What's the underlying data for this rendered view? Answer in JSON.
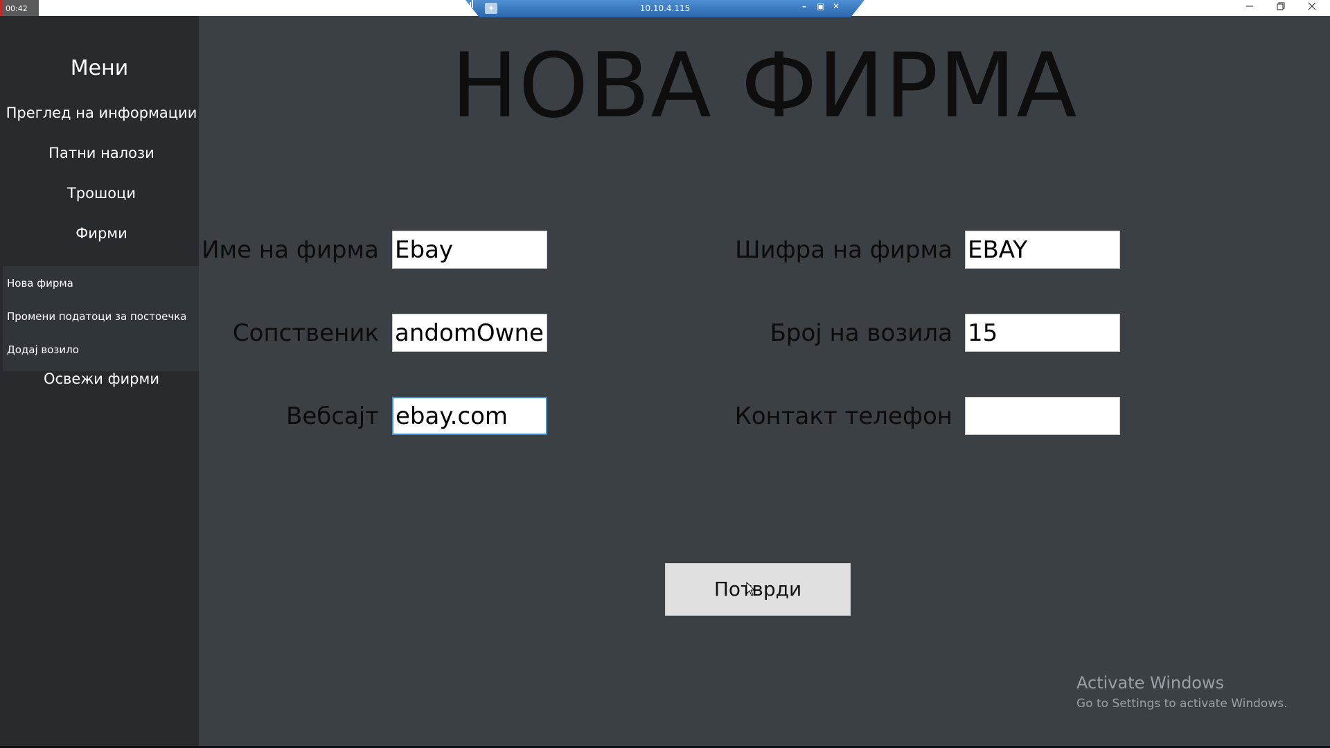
{
  "titlebar": {
    "clock": "00:42",
    "rdp_host": "10.10.4.115",
    "rdp_minimize": "–",
    "rdp_restore": "▣",
    "rdp_close": "✕"
  },
  "sidebar": {
    "title": "Мени",
    "items": [
      {
        "label": "Преглед на информации"
      },
      {
        "label": "Патни налози"
      },
      {
        "label": "Трошоци"
      },
      {
        "label": "Фирми"
      }
    ],
    "subitems": [
      {
        "label": "Нова фирма"
      },
      {
        "label": "Промени податоци за постоечка"
      },
      {
        "label": "Додај возило"
      }
    ],
    "refresh_label": "Освежи фирми"
  },
  "page": {
    "title": "НОВА ФИРМА"
  },
  "form": {
    "company_name": {
      "label": "Име на фирма",
      "value": "Ebay"
    },
    "owner": {
      "label": "Сопственик",
      "value": "andomOwner"
    },
    "website": {
      "label": "Вебсајт",
      "value": "ebay.com"
    },
    "company_code": {
      "label": "Шифра на фирма",
      "value": "EBAY"
    },
    "vehicle_count": {
      "label": "Број на возила",
      "value": "15"
    },
    "contact_phone": {
      "label": "Контакт телефон",
      "value": ""
    },
    "confirm_label": "Потврди"
  },
  "watermark": {
    "line1": "Activate Windows",
    "line2": "Go to Settings to activate Windows."
  },
  "colors": {
    "background": "#3b4045",
    "sidebar": "#272b2e",
    "rdp_bar": "#2f6fb5"
  }
}
